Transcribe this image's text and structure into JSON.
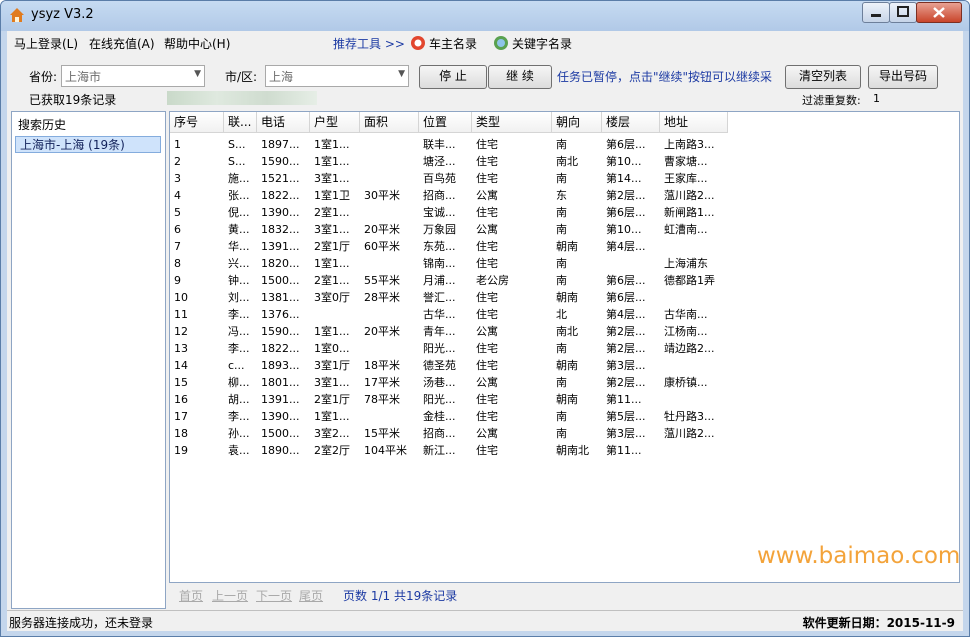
{
  "window": {
    "title": "ysyz V3.2"
  },
  "menu": {
    "login": "马上登录(L)",
    "recharge": "在线充值(A)",
    "help": "帮助中心(H)",
    "recommend": "推荐工具 >>",
    "tool1": "车主名录",
    "tool2": "关键字名录"
  },
  "filters": {
    "province_label": "省份:",
    "province_value": "上海市",
    "district_label": "市/区:",
    "district_value": "上海"
  },
  "buttons": {
    "stop": "停 止",
    "continue": "继 续",
    "clear": "清空列表",
    "export": "导出号码"
  },
  "messages": {
    "pause": "任务已暂停，点击\"继续\"按钮可以继续采",
    "records": "已获取19条记录",
    "dup_label": "过滤重复数:",
    "dup_value": "1"
  },
  "history": {
    "header": "搜索历史",
    "items": [
      "上海市-上海 (19条)"
    ]
  },
  "table": {
    "columns": [
      "序号",
      "联...",
      "电话",
      "户型",
      "面积",
      "位置",
      "类型",
      "朝向",
      "楼层",
      "地址"
    ],
    "rows": [
      [
        "1",
        "S...",
        "1897...",
        "1室1...",
        "",
        "联丰...",
        "住宅",
        "南",
        "第6层...",
        "上南路3..."
      ],
      [
        "2",
        "S...",
        "1590...",
        "1室1...",
        "",
        "塘泾...",
        "住宅",
        "南北",
        "第10...",
        "曹家塘..."
      ],
      [
        "3",
        "施...",
        "1521...",
        "3室1...",
        "",
        "百鸟苑",
        "住宅",
        "南",
        "第14...",
        "王家库..."
      ],
      [
        "4",
        "张...",
        "1822...",
        "1室1卫",
        "30平米",
        "招商...",
        "公寓",
        "东",
        "第2层...",
        "蕰川路2..."
      ],
      [
        "5",
        "倪...",
        "1390...",
        "2室1...",
        "",
        "宝诚...",
        "住宅",
        "南",
        "第6层...",
        "新闸路1..."
      ],
      [
        "6",
        "黄...",
        "1832...",
        "3室1...",
        "20平米",
        "万象园",
        "公寓",
        "南",
        "第10...",
        "虹漕南..."
      ],
      [
        "7",
        "华...",
        "1391...",
        "2室1厅",
        "60平米",
        "东苑...",
        "住宅",
        "朝南",
        "第4层...",
        ""
      ],
      [
        "8",
        "兴...",
        "1820...",
        "1室1...",
        "",
        "锦南...",
        "住宅",
        "南",
        "",
        "上海浦东"
      ],
      [
        "9",
        "钟...",
        "1500...",
        "2室1...",
        "55平米",
        "月浦...",
        "老公房",
        "南",
        "第6层...",
        "德都路1弄"
      ],
      [
        "10",
        "刘...",
        "1381...",
        "3室0厅",
        "28平米",
        "誉汇...",
        "住宅",
        "朝南",
        "第6层...",
        ""
      ],
      [
        "11",
        "李...",
        "1376...",
        "",
        "",
        "古华...",
        "住宅",
        "北",
        "第4层...",
        "古华南..."
      ],
      [
        "12",
        "冯...",
        "1590...",
        "1室1...",
        "20平米",
        "青年...",
        "公寓",
        "南北",
        "第2层...",
        "江杨南..."
      ],
      [
        "13",
        "李...",
        "1822...",
        "1室0...",
        "",
        "阳光...",
        "住宅",
        "南",
        "第2层...",
        "靖边路2..."
      ],
      [
        "14",
        "c...",
        "1893...",
        "3室1厅",
        "18平米",
        "德圣苑",
        "住宅",
        "朝南",
        "第3层...",
        ""
      ],
      [
        "15",
        "柳...",
        "1801...",
        "3室1...",
        "17平米",
        "汤巷...",
        "公寓",
        "南",
        "第2层...",
        "康桥镇..."
      ],
      [
        "16",
        "胡...",
        "1391...",
        "2室1厅",
        "78平米",
        "阳光...",
        "住宅",
        "朝南",
        "第11...",
        ""
      ],
      [
        "17",
        "李...",
        "1390...",
        "1室1...",
        "",
        "金桂...",
        "住宅",
        "南",
        "第5层...",
        "牡丹路3..."
      ],
      [
        "18",
        "孙...",
        "1500...",
        "3室2...",
        "15平米",
        "招商...",
        "公寓",
        "南",
        "第3层...",
        "蕰川路2..."
      ],
      [
        "19",
        "袁...",
        "1890...",
        "2室2厅",
        "104平米",
        "新江...",
        "住宅",
        "朝南北",
        "第11...",
        ""
      ]
    ]
  },
  "pager": {
    "first": "首页",
    "prev": "上一页",
    "next": "下一页",
    "last": "尾页",
    "info": "页数 1/1 共19条记录"
  },
  "watermark": "www.baimao.com",
  "status": {
    "left": "服务器连接成功，还未登录",
    "right": "软件更新日期：2015-11-9"
  }
}
